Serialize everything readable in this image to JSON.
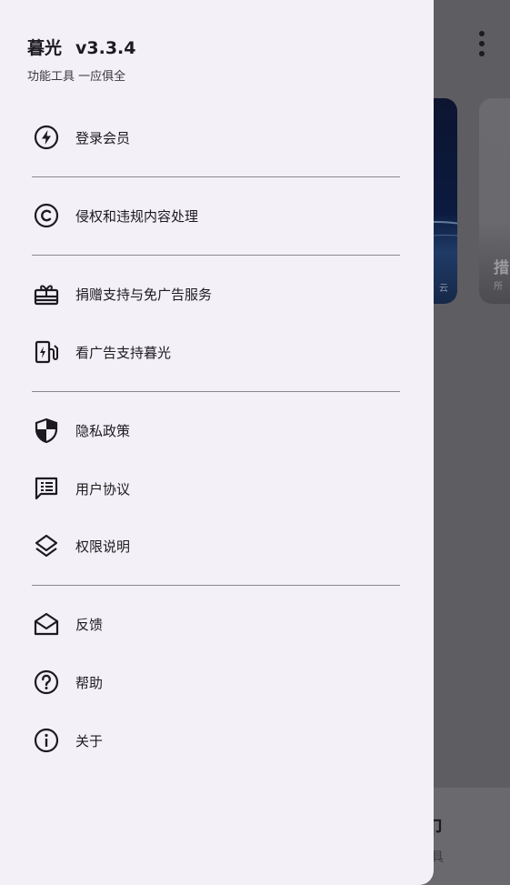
{
  "header": {
    "app_name": "暮光",
    "version": "v3.3.4",
    "subtitle": "功能工具 一应俱全"
  },
  "menu": {
    "login": "登录会员",
    "infringement": "侵权和违规内容处理",
    "donate": "捐赠支持与免广告服务",
    "watch_ad": "看广告支持暮光",
    "privacy": "隐私政策",
    "agreement": "用户协议",
    "permissions": "权限说明",
    "feedback": "反馈",
    "help": "帮助",
    "about": "关于"
  },
  "background": {
    "card2_title": "措",
    "card2_caption": "所",
    "card1_caption": "云",
    "bottom_glyph": "卩",
    "bottom_caption": "具"
  },
  "colors": {
    "drawer_bg": "#f4f0f7",
    "text": "#1c1b1f",
    "scrim": "#5e5d62",
    "divider": "#8a878d"
  }
}
